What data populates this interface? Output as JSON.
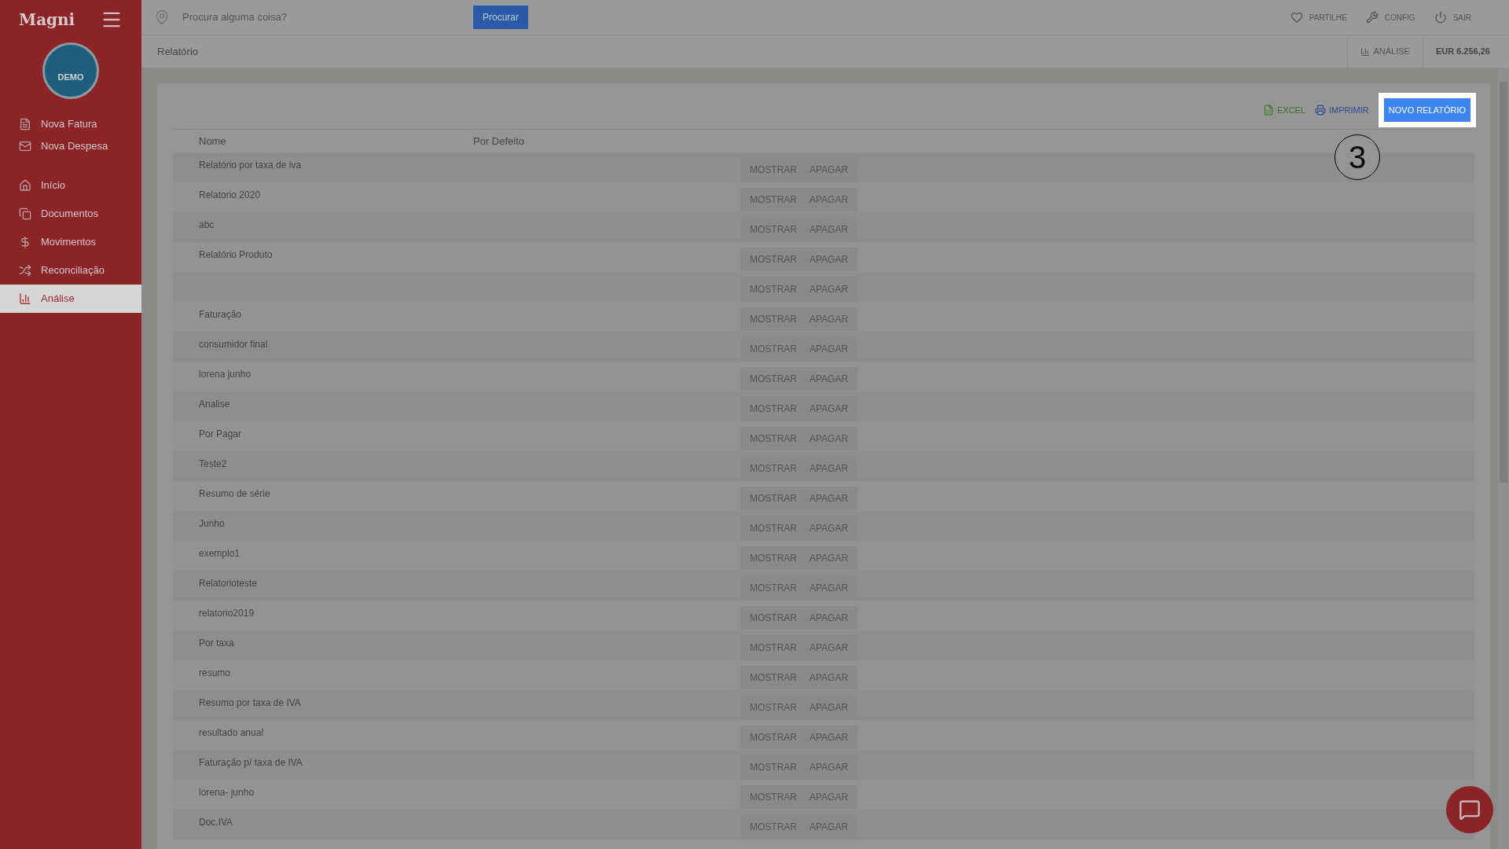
{
  "sidebar": {
    "logo": "Magni",
    "avatar_label": "DEMO",
    "quick_actions": [
      {
        "label": "Nova Fatura"
      },
      {
        "label": "Nova Despesa"
      }
    ],
    "items": [
      {
        "label": "Início",
        "selected": false
      },
      {
        "label": "Documentos",
        "selected": false
      },
      {
        "label": "Movimentos",
        "selected": false
      },
      {
        "label": "Reconciliação",
        "selected": false
      },
      {
        "label": "Análise",
        "selected": true
      }
    ]
  },
  "top_bar": {
    "search": {
      "placeholder": "Procura alguma coisa?"
    },
    "search_button": "Procurar",
    "links": [
      {
        "label": "PARTILHE"
      },
      {
        "label": "CONFIG"
      },
      {
        "label": "SAIR"
      }
    ]
  },
  "breadcrumb": {
    "title": "Relatório",
    "section": "ANÁLISE",
    "balance": "EUR 6.256,26"
  },
  "toolbar": {
    "excel": "EXCEL",
    "print": "IMPRIMIR",
    "new_report": "NOVO RELATÓRIO",
    "tour_step": "3"
  },
  "table": {
    "columns": [
      "Nome",
      "Por Defeito"
    ],
    "rows": [
      {
        "name": "Relatório por taxa de iva",
        "actions": [
          "MOSTRAR",
          "APAGAR"
        ]
      },
      {
        "name": "Relatorio 2020",
        "actions": [
          "MOSTRAR",
          "APAGAR"
        ]
      },
      {
        "name": "abc",
        "actions": [
          "MOSTRAR",
          "APAGAR"
        ]
      },
      {
        "name": "Relatório Produto",
        "actions": [
          "MOSTRAR",
          "APAGAR"
        ]
      },
      {
        "actions": [
          "MOSTRAR",
          "APAGAR"
        ]
      },
      {
        "name": "Faturação",
        "actions": [
          "MOSTRAR",
          "APAGAR"
        ]
      },
      {
        "name": "consumidor final",
        "actions": [
          "MOSTRAR",
          "APAGAR"
        ]
      },
      {
        "name": "lorena junho",
        "actions": [
          "MOSTRAR",
          "APAGAR"
        ]
      },
      {
        "name": "Analise",
        "actions": [
          "MOSTRAR",
          "APAGAR"
        ]
      },
      {
        "name": "Por Pagar",
        "actions": [
          "MOSTRAR",
          "APAGAR"
        ]
      },
      {
        "name": "Teste2",
        "actions": [
          "MOSTRAR",
          "APAGAR"
        ]
      },
      {
        "name": "Resumo de série",
        "actions": [
          "MOSTRAR",
          "APAGAR"
        ]
      },
      {
        "name": "Junho",
        "actions": [
          "MOSTRAR",
          "APAGAR"
        ]
      },
      {
        "name": "exemplo1",
        "actions": [
          "MOSTRAR",
          "APAGAR"
        ]
      },
      {
        "name": "Relatorioteste",
        "actions": [
          "MOSTRAR",
          "APAGAR"
        ]
      },
      {
        "name": "relatorio2019",
        "actions": [
          "MOSTRAR",
          "APAGAR"
        ]
      },
      {
        "name": "Por taxa",
        "actions": [
          "MOSTRAR",
          "APAGAR"
        ]
      },
      {
        "name": "resumo",
        "actions": [
          "MOSTRAR",
          "APAGAR"
        ]
      },
      {
        "name": "Resumo por taxa de IVA",
        "actions": [
          "MOSTRAR",
          "APAGAR"
        ]
      },
      {
        "name": "resultado anual",
        "actions": [
          "MOSTRAR",
          "APAGAR"
        ]
      },
      {
        "name": "Faturação p/ taxa de IVA",
        "actions": [
          "MOSTRAR",
          "APAGAR"
        ]
      },
      {
        "name": "lorena- junho",
        "actions": [
          "MOSTRAR",
          "APAGAR"
        ]
      },
      {
        "name": "Doc.IVA",
        "actions": [
          "MOSTRAR",
          "APAGAR"
        ]
      }
    ]
  }
}
